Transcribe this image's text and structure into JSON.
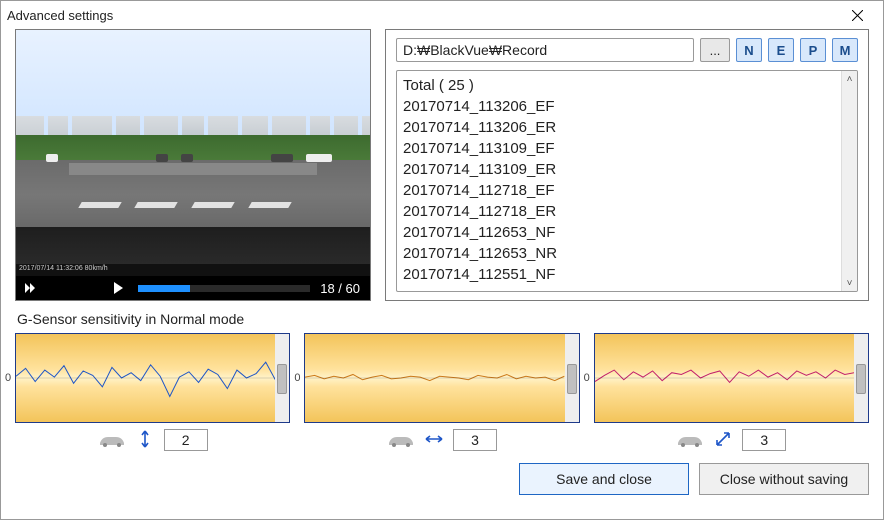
{
  "window": {
    "title": "Advanced settings"
  },
  "player": {
    "frame_counter": "18 / 60",
    "telemetry": "2017/07/14  11:32:06    80km/h"
  },
  "path_bar": {
    "path": "D:₩BlackVue₩Record",
    "browse_label": "...",
    "filters": {
      "n": "N",
      "e": "E",
      "p": "P",
      "m": "M"
    }
  },
  "file_list": {
    "total_label": "Total ( 25 )",
    "items": [
      "20170714_113206_EF",
      "20170714_113206_ER",
      "20170714_113109_EF",
      "20170714_113109_ER",
      "20170714_112718_EF",
      "20170714_112718_ER",
      "20170714_112653_NF",
      "20170714_112653_NR",
      "20170714_112551_NF"
    ]
  },
  "sensor": {
    "section_label": "G-Sensor sensitivity in Normal mode",
    "zero": "0",
    "values": {
      "x": "2",
      "y": "3",
      "z": "3"
    }
  },
  "buttons": {
    "save": "Save and close",
    "close": "Close without saving"
  },
  "chart_data": [
    {
      "type": "line",
      "title": "G-Sensor X",
      "ylim": [
        -5,
        5
      ],
      "ylabel": "0",
      "series": [
        {
          "name": "x",
          "color": "#1e56c8",
          "values": [
            0.2,
            1.1,
            -0.4,
            0.9,
            0.1,
            1.4,
            -0.6,
            0.8,
            0.3,
            -1.0,
            1.2,
            0.0,
            0.6,
            -0.3,
            1.5,
            0.2,
            -2.1,
            0.1,
            0.7,
            -0.5,
            1.0,
            0.4,
            -1.2,
            0.9,
            0.0,
            0.5,
            1.8,
            -0.2
          ]
        }
      ],
      "threshold": 2
    },
    {
      "type": "line",
      "title": "G-Sensor Y",
      "ylim": [
        -5,
        5
      ],
      "ylabel": "0",
      "series": [
        {
          "name": "y",
          "color": "#cc7a1a",
          "values": [
            0.1,
            0.3,
            -0.1,
            0.2,
            0.0,
            0.4,
            -0.2,
            0.1,
            0.3,
            -0.1,
            0.0,
            0.2,
            0.1,
            -0.3,
            0.2,
            0.1,
            0.0,
            -0.2,
            0.3,
            0.1,
            0.0,
            0.4,
            -0.1,
            0.2,
            0.0,
            0.1,
            -0.3,
            0.2
          ]
        }
      ],
      "threshold": 3
    },
    {
      "type": "line",
      "title": "G-Sensor Z",
      "ylim": [
        -5,
        5
      ],
      "ylabel": "0",
      "series": [
        {
          "name": "z",
          "color": "#c21f6b",
          "values": [
            -0.4,
            0.3,
            0.9,
            -0.2,
            0.7,
            0.1,
            0.8,
            -0.3,
            0.6,
            0.4,
            0.9,
            0.0,
            0.5,
            0.8,
            -0.5,
            0.7,
            0.2,
            0.9,
            0.1,
            0.6,
            -0.2,
            0.8,
            0.3,
            0.7,
            0.0,
            0.9,
            0.4,
            0.6
          ]
        }
      ],
      "threshold": 3
    }
  ]
}
